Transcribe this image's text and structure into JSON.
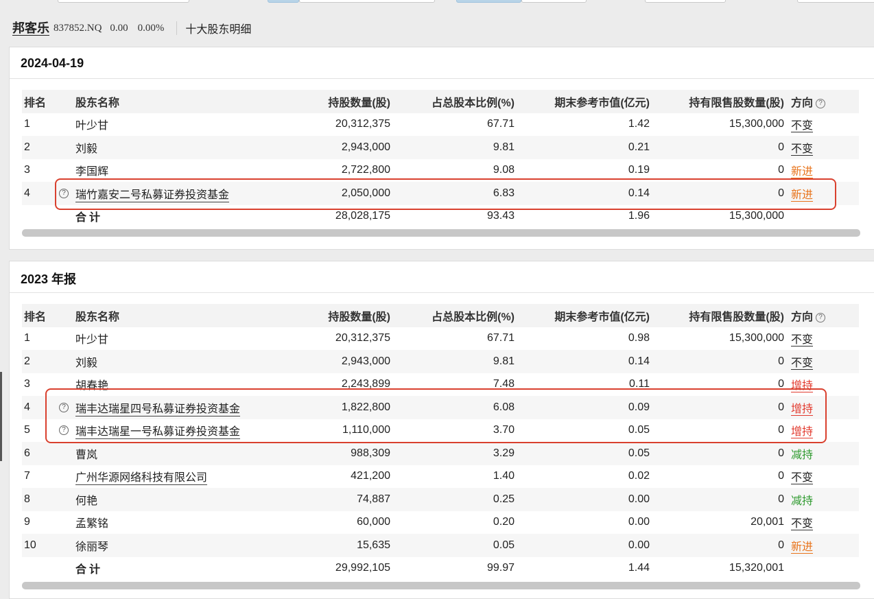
{
  "header": {
    "name": "邦客乐",
    "code": "837852.NQ",
    "price": "0.00",
    "change_pct": "0.00%",
    "title": "十大股东明细"
  },
  "columns": [
    "排名",
    "股东名称",
    "持股数量(股)",
    "占总股本比例(%)",
    "期末参考市值(亿元)",
    "持有限售股数量(股)",
    "方向"
  ],
  "colors": {
    "highlight": "#d9402e",
    "new": "#e8731a",
    "increase": "#e23a2e",
    "decrease": "#2f9a2f"
  },
  "sections": [
    {
      "title": "2024-04-19",
      "rows": [
        {
          "rank": "1",
          "q": false,
          "name": "叶少甘",
          "underline": false,
          "hold": "20,312,375",
          "pct": "67.71",
          "mv": "1.42",
          "lim": "15,300,000",
          "dir": "不变",
          "dir_type": "same"
        },
        {
          "rank": "2",
          "q": false,
          "name": "刘毅",
          "underline": false,
          "hold": "2,943,000",
          "pct": "9.81",
          "mv": "0.21",
          "lim": "0",
          "dir": "不变",
          "dir_type": "same"
        },
        {
          "rank": "3",
          "q": false,
          "name": "李国辉",
          "underline": false,
          "hold": "2,722,800",
          "pct": "9.08",
          "mv": "0.19",
          "lim": "0",
          "dir": "新进",
          "dir_type": "new"
        },
        {
          "rank": "4",
          "q": true,
          "name": "瑞竹嘉安二号私募证券投资基金",
          "underline": true,
          "hold": "2,050,000",
          "pct": "6.83",
          "mv": "0.14",
          "lim": "0",
          "dir": "新进",
          "dir_type": "new"
        }
      ],
      "total": {
        "label": "合计",
        "hold": "28,028,175",
        "pct": "93.43",
        "mv": "1.96",
        "lim": "15,300,000"
      }
    },
    {
      "title": "2023 年报",
      "rows": [
        {
          "rank": "1",
          "q": false,
          "name": "叶少甘",
          "underline": false,
          "hold": "20,312,375",
          "pct": "67.71",
          "mv": "0.98",
          "lim": "15,300,000",
          "dir": "不变",
          "dir_type": "same"
        },
        {
          "rank": "2",
          "q": false,
          "name": "刘毅",
          "underline": false,
          "hold": "2,943,000",
          "pct": "9.81",
          "mv": "0.14",
          "lim": "0",
          "dir": "不变",
          "dir_type": "same"
        },
        {
          "rank": "3",
          "q": false,
          "name": "胡春艳",
          "underline": false,
          "hold": "2,243,899",
          "pct": "7.48",
          "mv": "0.11",
          "lim": "0",
          "dir": "增持",
          "dir_type": "inc"
        },
        {
          "rank": "4",
          "q": true,
          "name": "瑞丰达瑞星四号私募证券投资基金",
          "underline": true,
          "hold": "1,822,800",
          "pct": "6.08",
          "mv": "0.09",
          "lim": "0",
          "dir": "增持",
          "dir_type": "inc"
        },
        {
          "rank": "5",
          "q": true,
          "name": "瑞丰达瑞星一号私募证券投资基金",
          "underline": true,
          "hold": "1,110,000",
          "pct": "3.70",
          "mv": "0.05",
          "lim": "0",
          "dir": "增持",
          "dir_type": "inc"
        },
        {
          "rank": "6",
          "q": false,
          "name": "曹岚",
          "underline": false,
          "hold": "988,309",
          "pct": "3.29",
          "mv": "0.05",
          "lim": "0",
          "dir": "减持",
          "dir_type": "dec"
        },
        {
          "rank": "7",
          "q": false,
          "name": "广州华源网络科技有限公司",
          "underline": true,
          "hold": "421,200",
          "pct": "1.40",
          "mv": "0.02",
          "lim": "0",
          "dir": "不变",
          "dir_type": "same"
        },
        {
          "rank": "8",
          "q": false,
          "name": "何艳",
          "underline": false,
          "hold": "74,887",
          "pct": "0.25",
          "mv": "0.00",
          "lim": "0",
          "dir": "减持",
          "dir_type": "dec"
        },
        {
          "rank": "9",
          "q": false,
          "name": "孟繁铭",
          "underline": false,
          "hold": "60,000",
          "pct": "0.20",
          "mv": "0.00",
          "lim": "20,001",
          "dir": "不变",
          "dir_type": "same"
        },
        {
          "rank": "10",
          "q": false,
          "name": "徐丽琴",
          "underline": false,
          "hold": "15,635",
          "pct": "0.05",
          "mv": "0.00",
          "lim": "0",
          "dir": "新进",
          "dir_type": "new"
        }
      ],
      "total": {
        "label": "合计",
        "hold": "29,992,105",
        "pct": "99.97",
        "mv": "1.44",
        "lim": "15,320,001"
      }
    }
  ]
}
